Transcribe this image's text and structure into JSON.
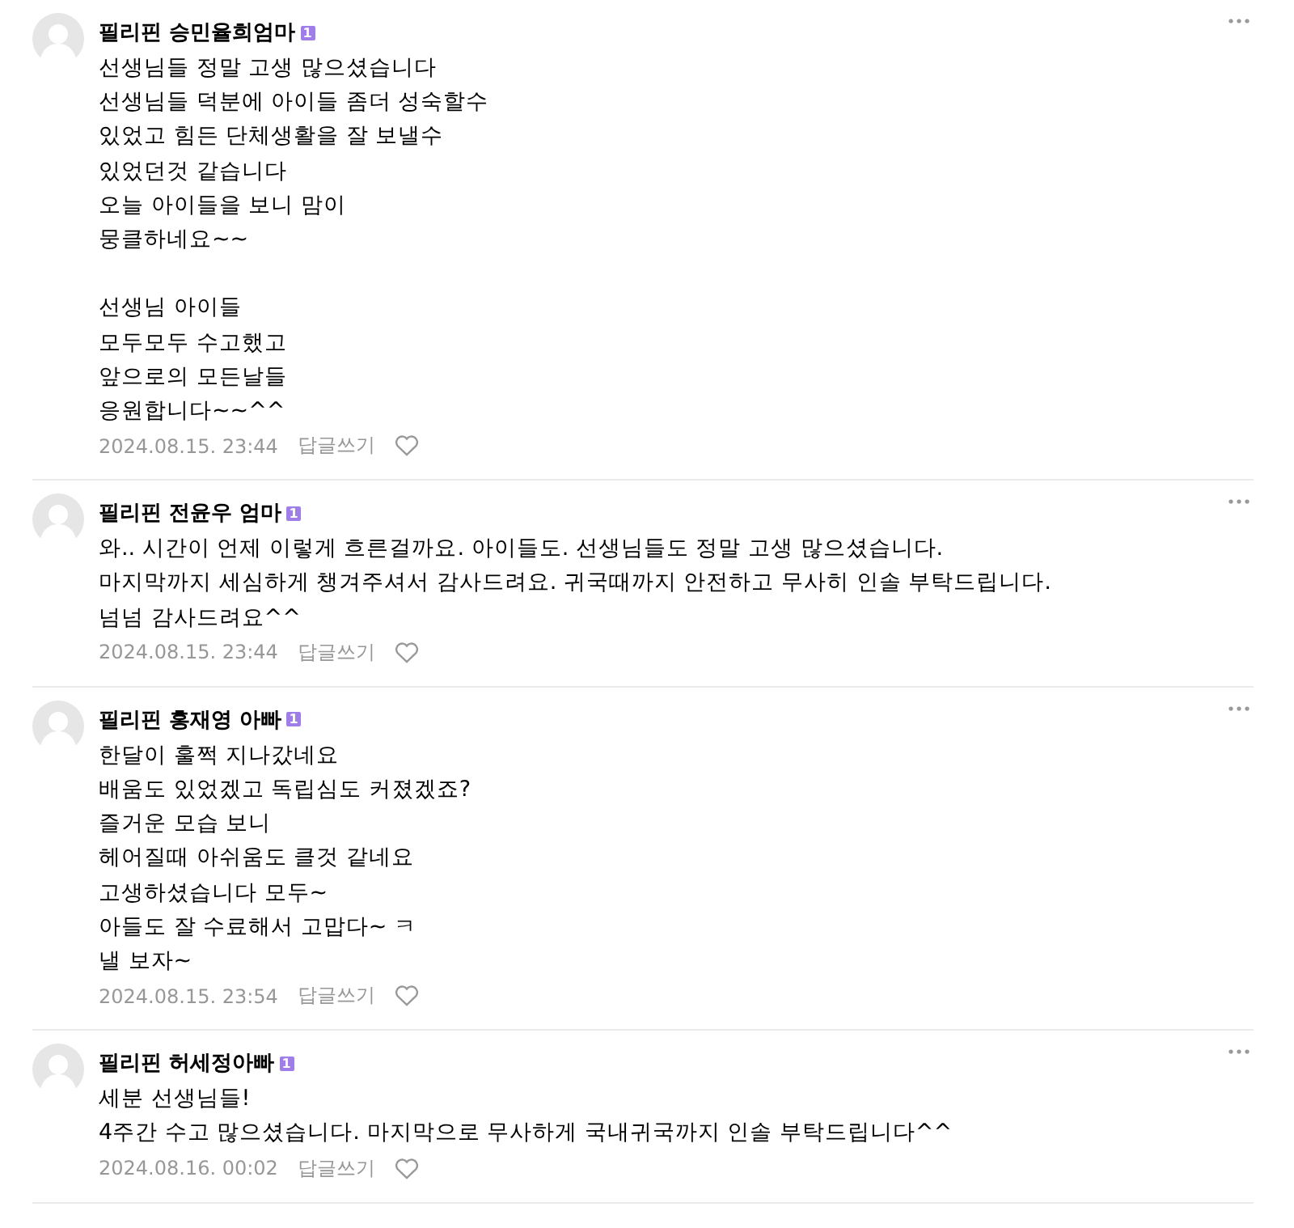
{
  "comments": [
    {
      "author": "필리핀 승민율희엄마",
      "badge": "1",
      "text": "선생님들 정말 고생 많으셨습니다\n선생님들 덕분에 아이들 좀더 성숙할수\n있었고 힘든 단체생활을 잘 보낼수\n있었던것 같습니다\n오늘 아이들을 보니 맘이\n뭉클하네요~~\n\n선생님 아이들\n모두모두 수고했고\n앞으로의 모든날들\n응원합니다~~^^",
      "date": "2024.08.15. 23:44",
      "reply": "답글쓰기"
    },
    {
      "author": "필리핀 전윤우 엄마",
      "badge": "1",
      "text": "와.. 시간이 언제 이렇게 흐른걸까요. 아이들도. 선생님들도 정말 고생 많으셨습니다.\n마지막까지 세심하게 챙겨주셔서 감사드려요. 귀국때까지 안전하고 무사히 인솔 부탁드립니다.\n넘넘 감사드려요^^",
      "date": "2024.08.15. 23:44",
      "reply": "답글쓰기"
    },
    {
      "author": "필리핀 홍재영 아빠",
      "badge": "1",
      "text": "한달이 훌쩍 지나갔네요\n배움도 있었겠고 독립심도 커졌겠죠?\n즐거운 모습 보니\n헤어질때 아쉬움도 클것 같네요\n고생하셨습니다 모두~\n아들도 잘 수료해서 고맙다~ ㅋ\n낼 보자~",
      "date": "2024.08.15. 23:54",
      "reply": "답글쓰기"
    },
    {
      "author": "필리핀 허세정아빠",
      "badge": "1",
      "text": "세분 선생님들!\n4주간 수고 많으셨습니다. 마지막으로 무사하게 국내귀국까지 인솔 부탁드립니다^^",
      "date": "2024.08.16. 00:02",
      "reply": "답글쓰기"
    }
  ]
}
